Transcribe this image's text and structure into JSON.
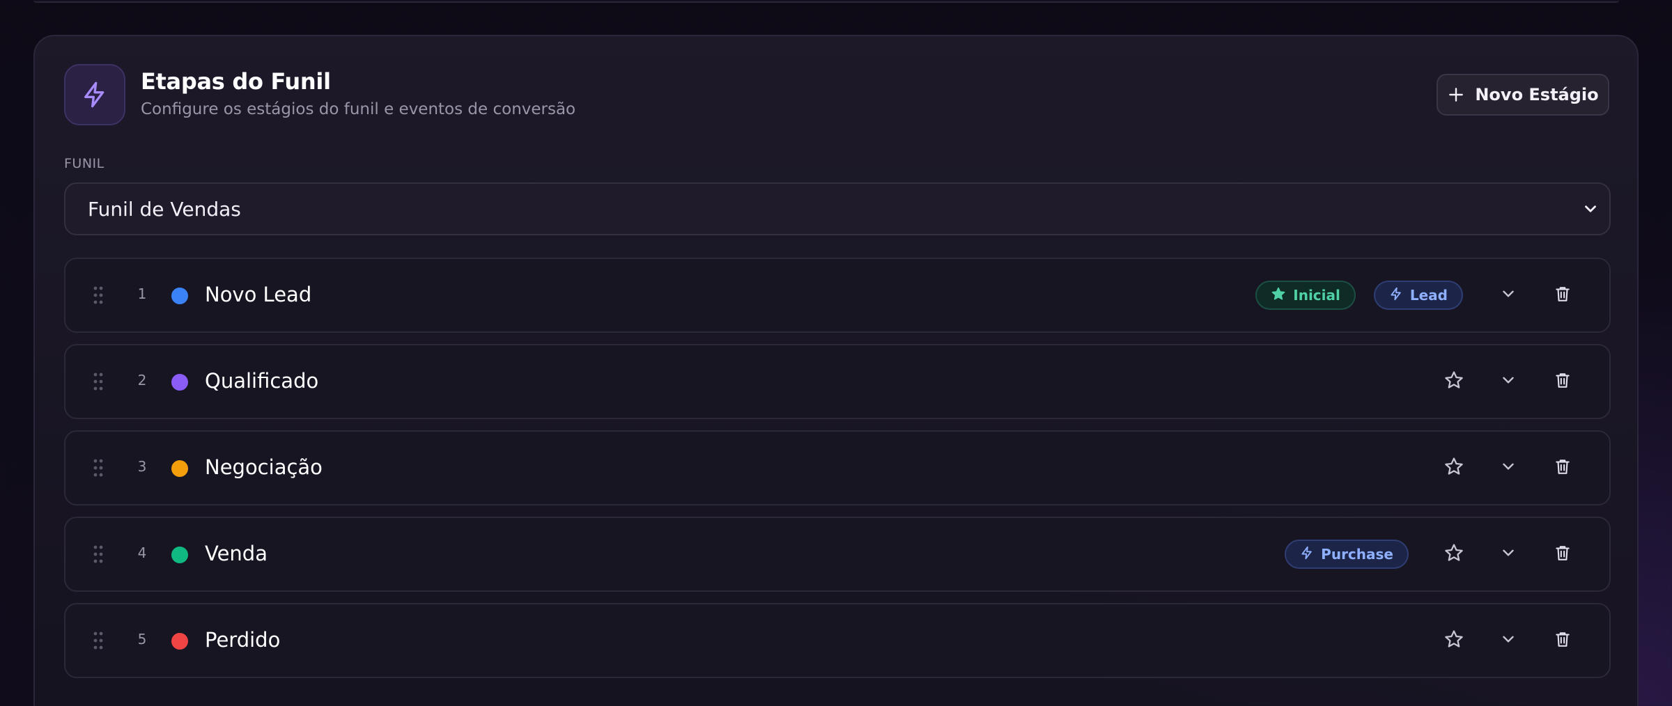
{
  "header": {
    "title": "Etapas do Funil",
    "subtitle": "Configure os estágios do funil e eventos de conversão",
    "new_stage_label": "Novo Estágio"
  },
  "funnel": {
    "label": "FUNIL",
    "selected": "Funil de Vendas"
  },
  "colors": {
    "accent": "#a78bfa",
    "blue": "#3b82f6",
    "purple": "#8b5cf6",
    "orange": "#f59e0b",
    "green": "#10b981",
    "red": "#ef4444"
  },
  "stages": [
    {
      "number": "1",
      "name": "Novo Lead",
      "color": "#3b82f6",
      "initial_badge": "Inicial",
      "event_badge": "Lead"
    },
    {
      "number": "2",
      "name": "Qualificado",
      "color": "#8b5cf6"
    },
    {
      "number": "3",
      "name": "Negociação",
      "color": "#f59e0b"
    },
    {
      "number": "4",
      "name": "Venda",
      "color": "#10b981",
      "event_badge": "Purchase"
    },
    {
      "number": "5",
      "name": "Perdido",
      "color": "#ef4444"
    }
  ],
  "icons": {
    "header": "lightning-icon",
    "add": "plus-icon",
    "select": "chevron-down-icon",
    "drag": "drag-handle-icon",
    "star": "star-icon",
    "expand": "chevron-down-icon",
    "delete": "trash-icon"
  }
}
